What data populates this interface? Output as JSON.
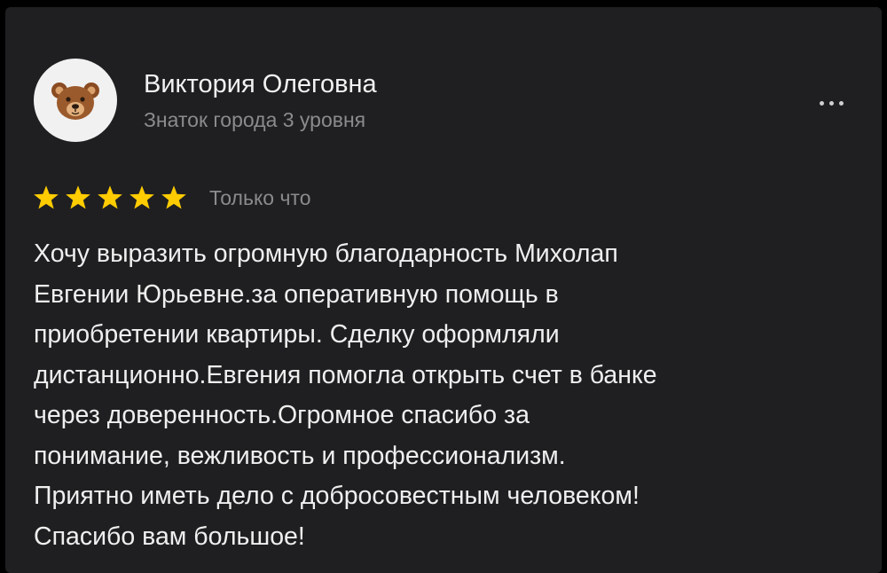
{
  "review": {
    "author": {
      "name": "Виктория Олеговна",
      "level": "Знаток города 3 уровня",
      "avatar_icon": "bear-face-icon"
    },
    "menu_icon": "more-dots-icon",
    "rating": {
      "stars": 5,
      "max_stars": 5,
      "star_color": "#ffcc00"
    },
    "time": "Только что",
    "text_lines": [
      "Хочу выразить огромную благодарность Михолап",
      "Евгении Юрьевне.за оперативную помощь в",
      "приобретении квартиры. Сделку оформляли",
      "дистанционно.Евгения помогла открыть счет в банке",
      "через доверенность.Огромное спасибо за",
      "понимание, вежливость и профессионализм.",
      "Приятно иметь дело с добросовестным человеком!",
      "Спасибо вам большое!"
    ]
  },
  "colors": {
    "background": "#000000",
    "card": "#1f1f21",
    "primary_text": "#f2f2f2",
    "secondary_text": "#8b8b8e",
    "avatar_background": "#f1f1f1"
  }
}
